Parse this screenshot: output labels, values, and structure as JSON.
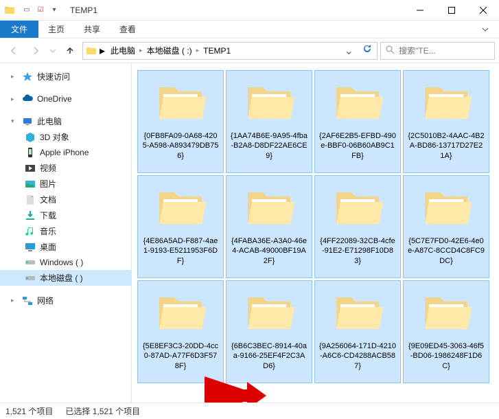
{
  "window": {
    "title": "TEMP1"
  },
  "ribbon": {
    "file": "文件",
    "home": "主页",
    "share": "共享",
    "view": "查看"
  },
  "breadcrumb": {
    "pc": "此电脑",
    "drive": "本地磁盘 (  :)",
    "folder": "TEMP1"
  },
  "search": {
    "placeholder": "搜索\"TE..."
  },
  "sidebar": {
    "quick": "快速访问",
    "onedrive": "OneDrive",
    "pc": "此电脑",
    "children": {
      "3d": "3D 对象",
      "iphone": "Apple iPhone",
      "videos": "视频",
      "pictures": "图片",
      "docs": "文档",
      "downloads": "下载",
      "music": "音乐",
      "desktop": "桌面",
      "winDrive": "Windows (   )",
      "localDrive": "本地磁盘 (    )"
    },
    "network": "网络"
  },
  "items": {
    "0": "{0FB8FA09-0A68-4205-A598-A893479DB756}",
    "1": "{1AA74B6E-9A95-4fba-B2A8-D8DF22AE6CE9}",
    "2": "{2AF6E2B5-EFBD-490e-BBF0-06B60AB9C1FB}",
    "3": "{2C5010B2-4AAC-4B2A-BD86-13717D27E21A}",
    "4": "{4E86A5AD-F887-4ae1-9193-E5211953F6DF}",
    "5": "{4FABA36E-A3A0-46e4-ACAB-49000BF19A2F}",
    "6": "{4FF22089-32CB-4cfe-91E2-E71298F10D83}",
    "7": "{5C7E7FD0-42E6-4e0e-A87C-8CCD4C8FC9DC}",
    "8": "{5E8EF3C3-20DD-4cc0-87AD-A77F6D3F578F}",
    "9": "{6B6C3BEC-8914-40aa-9166-25EF4F2C3AD6}",
    "10": "{9A256064-171D-4210-A6C6-CD4288ACB587}",
    "11": "{9E09ED45-3063-46f5-BD06-1986248F1D6C}"
  },
  "status": {
    "count": "1,521 个项目",
    "selected": "已选择 1,521 个项目"
  }
}
